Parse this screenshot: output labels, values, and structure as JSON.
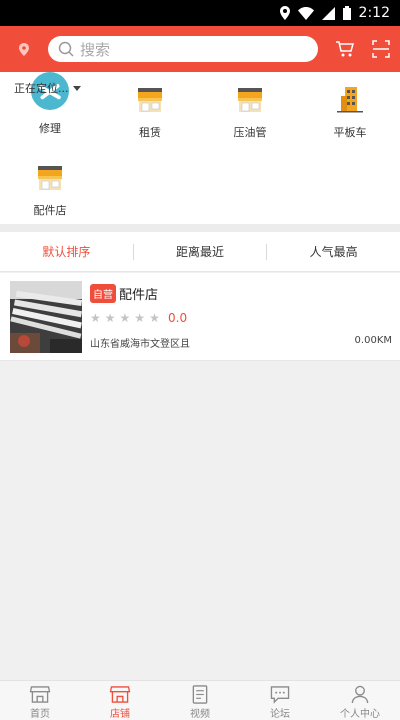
{
  "status_bar": {
    "time": "2:12"
  },
  "header": {
    "search_placeholder": "搜索"
  },
  "location": {
    "text": "正在定位..."
  },
  "categories": [
    {
      "label": "修理",
      "icon": "repair-icon"
    },
    {
      "label": "租赁",
      "icon": "shop-icon"
    },
    {
      "label": "压油管",
      "icon": "shop-icon"
    },
    {
      "label": "平板车",
      "icon": "building-icon"
    },
    {
      "label": "配件店",
      "icon": "shop-icon"
    }
  ],
  "sort_tabs": [
    {
      "label": "默认排序",
      "active": true
    },
    {
      "label": "距离最近",
      "active": false
    },
    {
      "label": "人气最高",
      "active": false
    }
  ],
  "stores": [
    {
      "badge": "自营",
      "name": "配件店",
      "rating": "0.0",
      "stars": 0,
      "address": "山东省威海市文登区且",
      "distance": "0.00KM"
    }
  ],
  "tabbar": [
    {
      "label": "首页",
      "icon": "home-store-icon",
      "active": false
    },
    {
      "label": "店铺",
      "icon": "shop-icon",
      "active": true
    },
    {
      "label": "视频",
      "icon": "document-icon",
      "active": false
    },
    {
      "label": "论坛",
      "icon": "chat-icon",
      "active": false
    },
    {
      "label": "个人中心",
      "icon": "person-icon",
      "active": false
    }
  ],
  "colors": {
    "accent": "#f04d3b",
    "badge": "#f04d3b",
    "shop_awning": "#f3a51d"
  }
}
